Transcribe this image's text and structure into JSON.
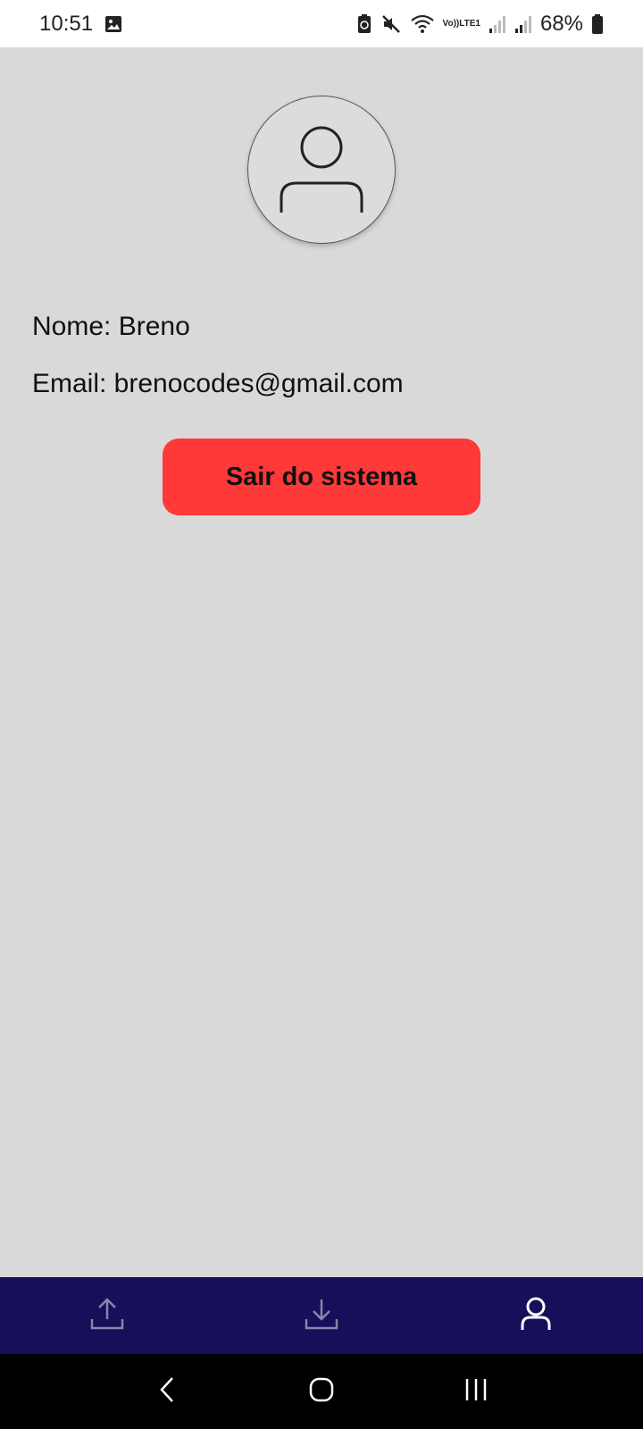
{
  "status_bar": {
    "time": "10:51",
    "lte_top": "Vo))",
    "lte_bottom": "LTE1",
    "battery": "68%"
  },
  "profile": {
    "avatar_icon": "user-icon",
    "name_line": "Nome: Breno",
    "email_line": "Email: brenocodes@gmail.com",
    "logout_label": "Sair do sistema"
  },
  "bottom_nav": {
    "items": [
      {
        "icon": "upload-icon",
        "active": false
      },
      {
        "icon": "download-icon",
        "active": false
      },
      {
        "icon": "user-icon",
        "active": true
      }
    ]
  },
  "colors": {
    "background": "#d9d9d9",
    "nav_background": "#170f5a",
    "logout_button": "#ff3838",
    "nav_icon_inactive": "#8a86a8",
    "nav_icon_active": "#ffffff"
  }
}
